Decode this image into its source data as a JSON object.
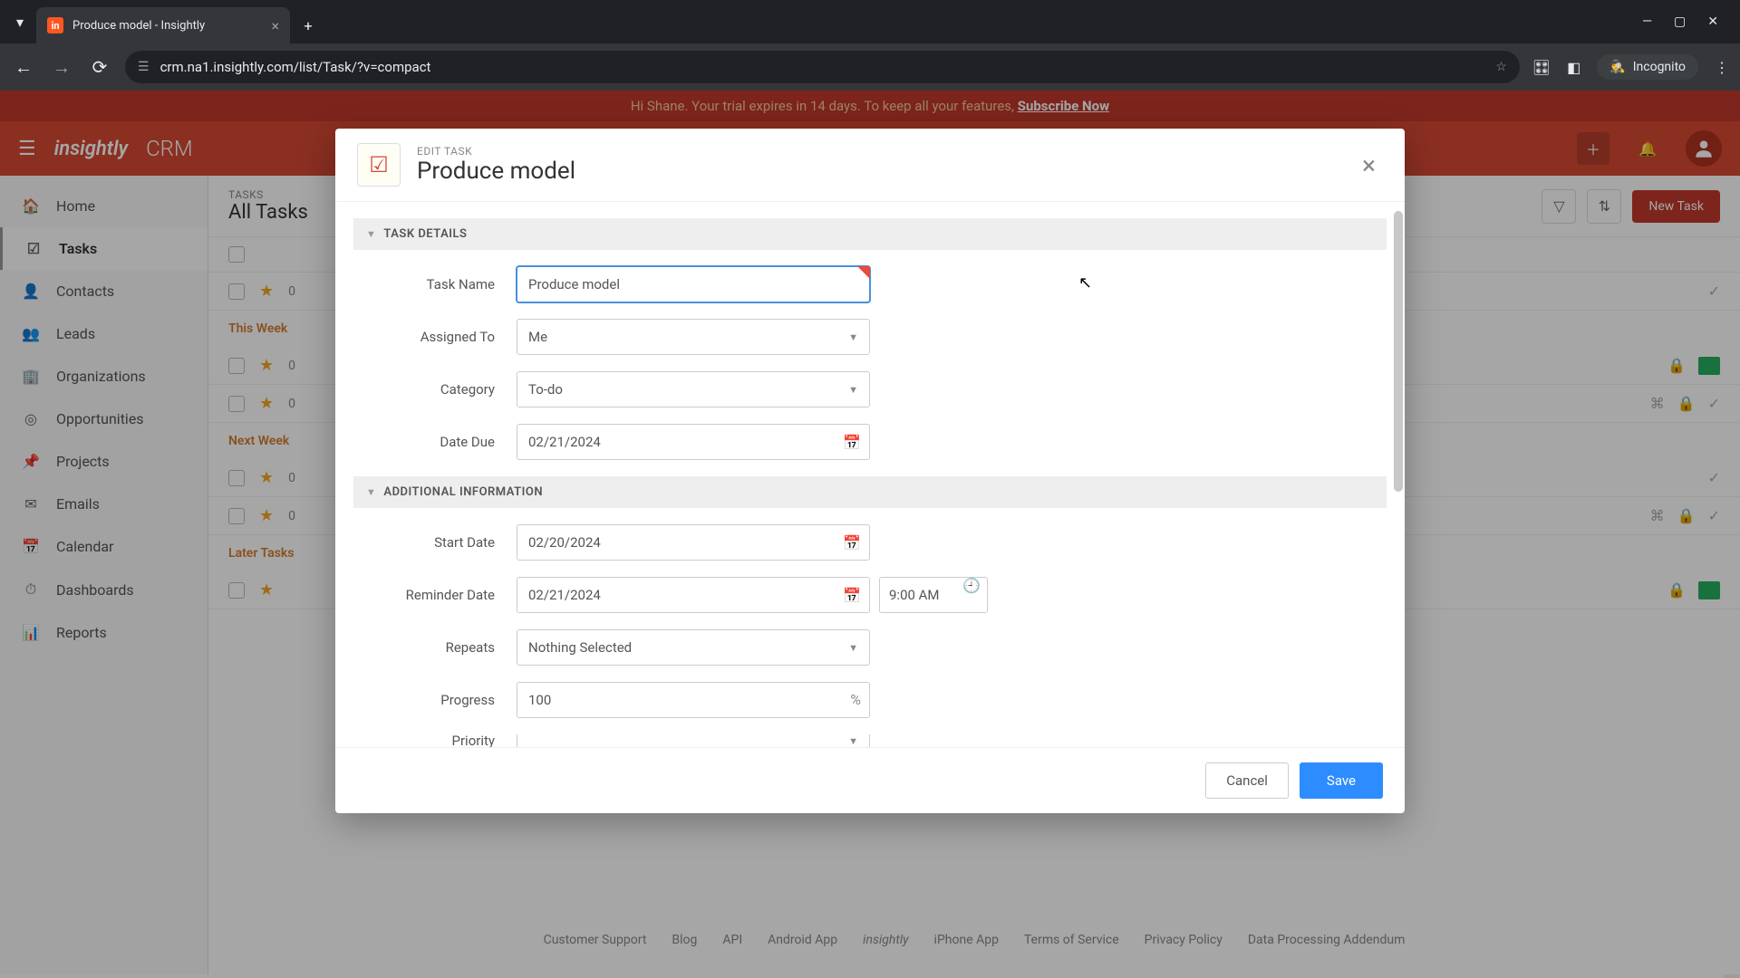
{
  "browser": {
    "tab_title": "Produce model - Insightly",
    "url": "crm.na1.insightly.com/list/Task/?v=compact",
    "incognito": "Incognito"
  },
  "banner": {
    "text_prefix": "Hi Shane. Your trial expires in 14 days. To keep all your features, ",
    "link": "Subscribe Now"
  },
  "header": {
    "logo": "insightly",
    "product": "CRM"
  },
  "sidebar": {
    "items": [
      {
        "label": "Home"
      },
      {
        "label": "Tasks"
      },
      {
        "label": "Contacts"
      },
      {
        "label": "Leads"
      },
      {
        "label": "Organizations"
      },
      {
        "label": "Opportunities"
      },
      {
        "label": "Projects"
      },
      {
        "label": "Emails"
      },
      {
        "label": "Calendar"
      },
      {
        "label": "Dashboards"
      },
      {
        "label": "Reports"
      }
    ]
  },
  "list": {
    "subtitle": "TASKS",
    "title": "All Tasks",
    "new_button": "New Task",
    "groups": [
      {
        "label": "This Week"
      },
      {
        "label": "Next Week"
      },
      {
        "label": "Later Tasks"
      }
    ],
    "date_fragment": "0"
  },
  "footer": {
    "links": [
      "Customer Support",
      "Blog",
      "API",
      "Android App",
      "iPhone App",
      "Terms of Service",
      "Privacy Policy",
      "Data Processing Addendum"
    ]
  },
  "modal": {
    "subtitle": "EDIT TASK",
    "title": "Produce model",
    "section_details": "TASK DETAILS",
    "section_additional": "ADDITIONAL INFORMATION",
    "labels": {
      "task_name": "Task Name",
      "assigned_to": "Assigned To",
      "category": "Category",
      "date_due": "Date Due",
      "start_date": "Start Date",
      "reminder_date": "Reminder Date",
      "repeats": "Repeats",
      "progress": "Progress",
      "priority": "Priority"
    },
    "values": {
      "task_name": "Produce model",
      "assigned_to": "Me",
      "category": "To-do",
      "date_due": "02/21/2024",
      "start_date": "02/20/2024",
      "reminder_date": "02/21/2024",
      "reminder_time": "9:00 AM",
      "repeats": "Nothing Selected",
      "progress": "100"
    },
    "buttons": {
      "cancel": "Cancel",
      "save": "Save"
    }
  }
}
